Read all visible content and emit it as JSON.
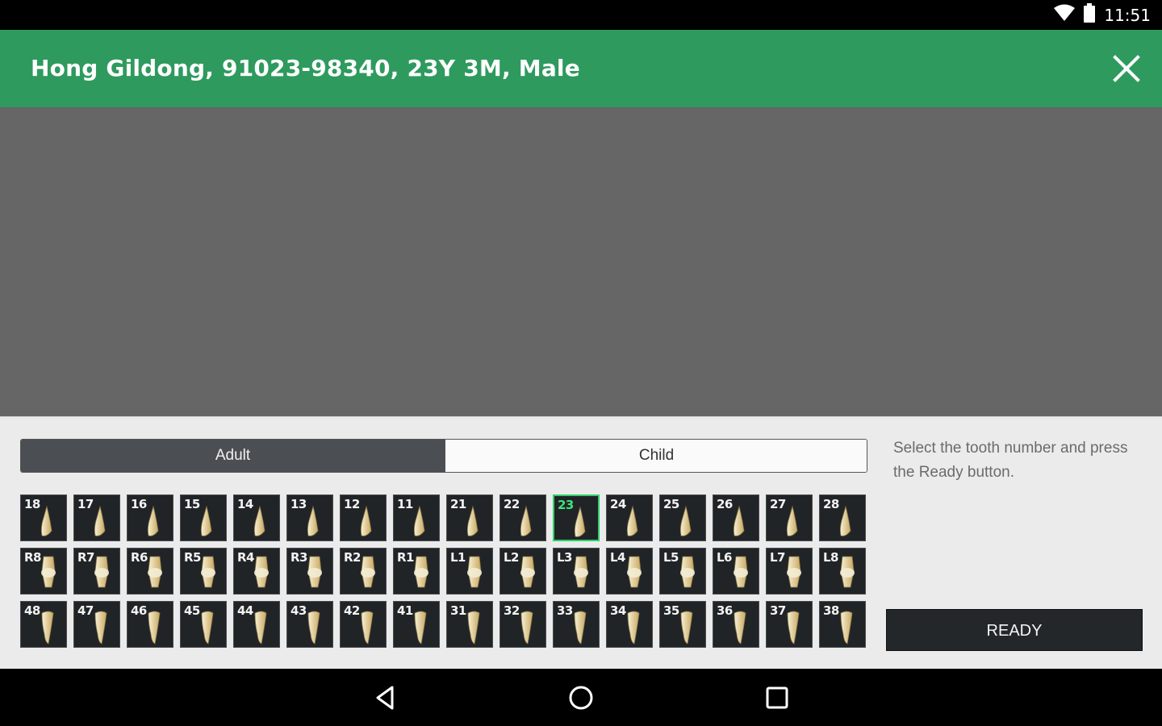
{
  "status_bar": {
    "time": "11:51",
    "icons": [
      "wifi-icon",
      "battery-icon"
    ]
  },
  "toolbar": {
    "title": "Hong Gildong, 91023-98340, 23Y 3M, Male",
    "close_icon": "close-icon"
  },
  "segment": {
    "options": [
      "Adult",
      "Child"
    ],
    "selected": "Adult"
  },
  "teeth": {
    "rows": [
      [
        "18",
        "17",
        "16",
        "15",
        "14",
        "13",
        "12",
        "11",
        "21",
        "22",
        "23",
        "24",
        "25",
        "26",
        "27",
        "28"
      ],
      [
        "R8",
        "R7",
        "R6",
        "R5",
        "R4",
        "R3",
        "R2",
        "R1",
        "L1",
        "L2",
        "L3",
        "L4",
        "L5",
        "L6",
        "L7",
        "L8"
      ],
      [
        "48",
        "47",
        "46",
        "45",
        "44",
        "43",
        "42",
        "41",
        "31",
        "32",
        "33",
        "34",
        "35",
        "36",
        "37",
        "38"
      ]
    ],
    "selected": "23"
  },
  "hint": "Select the tooth number and press the Ready button.",
  "ready_button": "READY",
  "colors": {
    "accent": "#2e9a5e",
    "selected_border": "#2fcf6a",
    "tooth_bg": "#212427"
  },
  "navbar": {
    "icons": [
      "back-icon",
      "home-icon",
      "recents-icon"
    ]
  }
}
